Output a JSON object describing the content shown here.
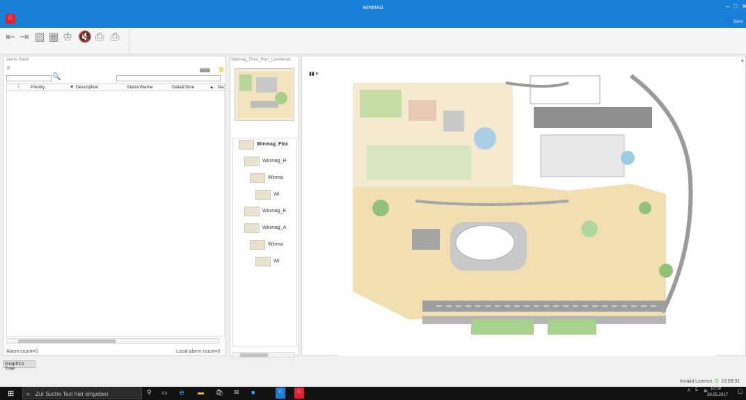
{
  "window": {
    "title": "WINMAG",
    "user": "Serv",
    "logo_glyph": "鱼"
  },
  "toolbar": {
    "buttons": [
      "back-icon",
      "forward-icon",
      "graph-icon",
      "grid-icon",
      "people-icon",
      "mute-icon",
      "print-icon",
      "print-preview-icon"
    ]
  },
  "alarm_stack": {
    "title": "Alarm Stack",
    "columns": [
      "Priority",
      "Description",
      "StationName",
      "Date&Time",
      "Na"
    ],
    "hscroll_position": 0.45,
    "alarm_count": "Alarm count=0",
    "local_alarm_count": "Local alarm count=0"
  },
  "floor_plan": {
    "title": "Winmag_Floor_Plan_Combined",
    "tree": [
      {
        "label": "Winmag_Floc",
        "bold": true
      },
      {
        "label": "Winmag_R"
      },
      {
        "label": "Winma"
      },
      {
        "label": "Wi"
      },
      {
        "label": "Winmag_E"
      },
      {
        "label": "Winmag_A"
      },
      {
        "label": "Winma"
      },
      {
        "label": "Wi"
      }
    ]
  },
  "graphics_tree_tab": "Graphics Tree",
  "statusbar": {
    "license": "Invalid License",
    "clock": "10:58:31"
  },
  "taskbar": {
    "search_placeholder": "Zur Suche Text hier eingeben",
    "time": "10:58",
    "date": "29.05.2017"
  }
}
